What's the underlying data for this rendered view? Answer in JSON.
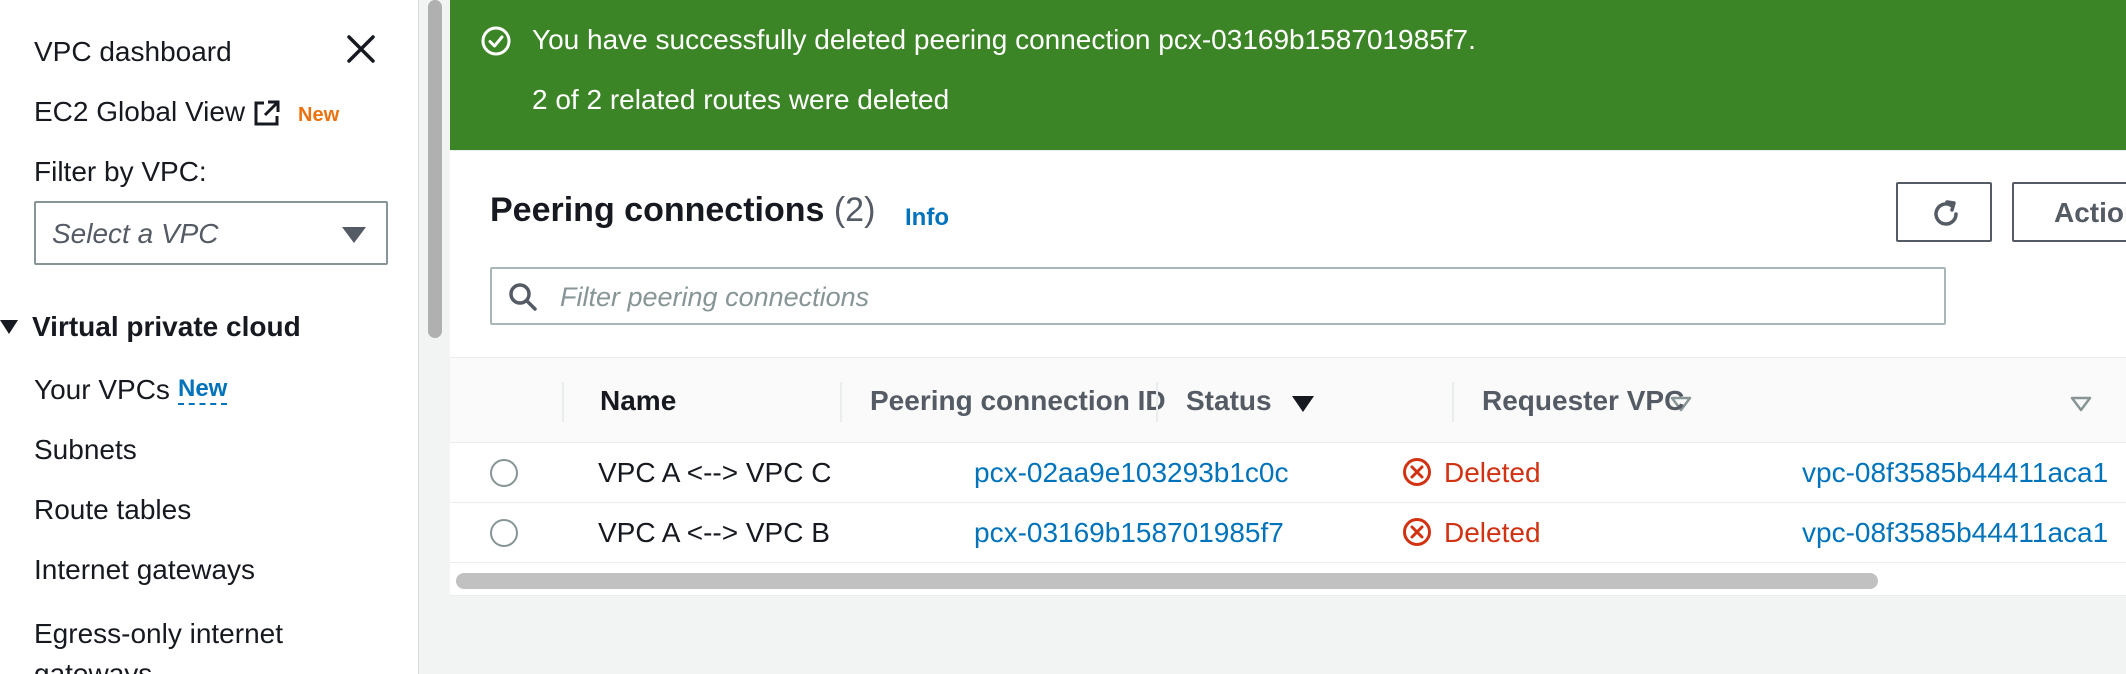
{
  "sidebar": {
    "vpc_dashboard": "VPC dashboard",
    "global_view": "EC2 Global View",
    "global_view_badge": "New",
    "filter_label": "Filter by VPC:",
    "filter_placeholder": "Select a VPC",
    "section_title": "Virtual private cloud",
    "items": [
      {
        "label": "Your VPCs",
        "badge": "New"
      },
      {
        "label": "Subnets"
      },
      {
        "label": "Route tables"
      },
      {
        "label": "Internet gateways"
      },
      {
        "label": "Egress-only internet gateways"
      }
    ]
  },
  "flash": {
    "message": "You have successfully deleted peering connection pcx-03169b158701985f7.",
    "sub_message": "2 of 2 related routes were deleted",
    "color": "#3b8526"
  },
  "panel": {
    "title": "Peering connections",
    "count": "(2)",
    "info": "Info",
    "actions_label": "Actions",
    "search_placeholder": "Filter peering connections"
  },
  "table": {
    "columns": [
      "Name",
      "Peering connection ID",
      "Status",
      "Requester VPC"
    ],
    "rows": [
      {
        "name": "VPC A <--> VPC C",
        "peering_id": "pcx-02aa9e103293b1c0c",
        "status": "Deleted",
        "requester_vpc": "vpc-08f3585b44411aca1"
      },
      {
        "name": "VPC A <--> VPC B",
        "peering_id": "pcx-03169b158701985f7",
        "status": "Deleted",
        "requester_vpc": "vpc-08f3585b44411aca1"
      }
    ]
  },
  "colors": {
    "link": "#0073bb",
    "status_deleted": "#d13212",
    "badge_orange": "#ec7211"
  },
  "icons": [
    "close-icon",
    "external-link-icon",
    "caret-down-icon",
    "success-check-icon",
    "refresh-icon",
    "search-icon",
    "sort-icon",
    "error-x-icon"
  ]
}
